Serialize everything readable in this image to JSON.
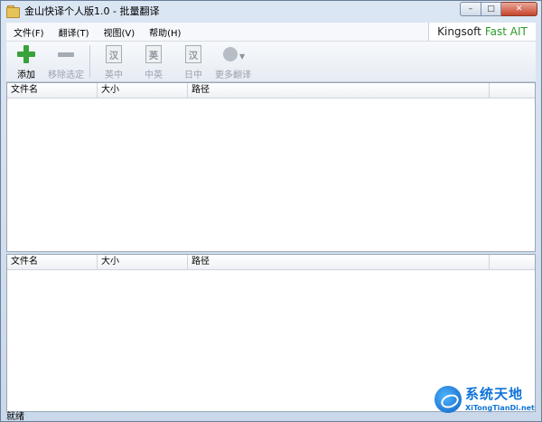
{
  "window": {
    "title": "金山快译个人版1.0 - 批量翻译",
    "buttons": {
      "minimize": "–",
      "maximize": "□",
      "close": "✕"
    }
  },
  "menu": {
    "items": [
      "文件(F)",
      "翻译(T)",
      "视图(V)",
      "帮助(H)"
    ],
    "brand_part1": "Kingsoft",
    "brand_part2": "Fast AIT"
  },
  "toolbar": {
    "add": "添加",
    "remove": "移除选定",
    "en_cn": "英中",
    "cn_en": "中英",
    "jp_cn": "日中",
    "more": "更多翻译",
    "en_cn_icon_char": "汉",
    "cn_en_icon_char": "英",
    "jp_cn_icon_char": "汉"
  },
  "list_top": {
    "columns": [
      "文件名",
      "大小",
      "路径"
    ]
  },
  "list_bottom": {
    "columns": [
      "文件名",
      "大小",
      "路径"
    ]
  },
  "status": {
    "text": "就绪"
  },
  "watermark": {
    "cn": "系统天地",
    "en": "XiTongTianDi.net"
  },
  "colors": {
    "accent_green": "#37a33a",
    "brand_green": "#2b9a2b",
    "watermark_blue": "#0f74d8"
  }
}
